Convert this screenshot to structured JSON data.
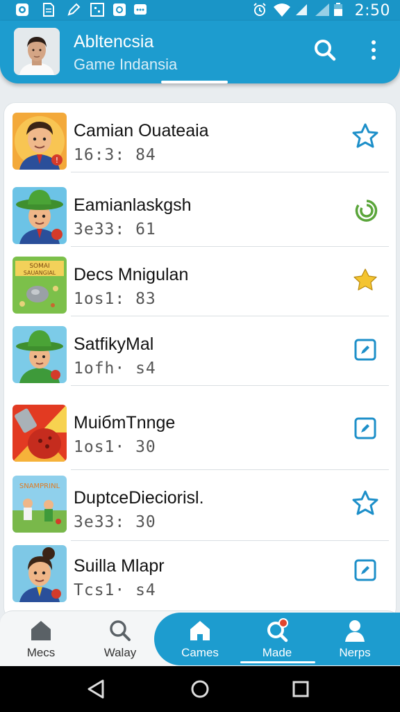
{
  "status_bar": {
    "time": "2:50",
    "left_icons": [
      "app-icon",
      "document-icon",
      "edit-icon",
      "grid-icon",
      "photo-icon",
      "message-icon"
    ],
    "right_icons": [
      "alarm-icon",
      "wifi-icon",
      "signal-icon",
      "battery-icon"
    ]
  },
  "app_bar": {
    "title": "Abltencsia",
    "subtitle": "Game Indansia",
    "actions": [
      "search-icon",
      "more-vert-icon"
    ]
  },
  "list": {
    "items": [
      {
        "title": "Camian Ouateaia",
        "subtitle": "16:3: 84",
        "action_icon": "star-outline-icon"
      },
      {
        "title": "Eamianlaskgsh",
        "subtitle": "3e33: 61",
        "action_icon": "sync-icon"
      },
      {
        "title": "Decs Mnigulan",
        "subtitle": "1os1: 83",
        "action_icon": "star-filled-icon"
      },
      {
        "title": "SatfikyMal",
        "subtitle": "1ofh· s4",
        "action_icon": "edit-box-icon"
      },
      {
        "title": "MuiбmTnnge",
        "subtitle": "1os1· 30",
        "action_icon": "edit-box-icon"
      },
      {
        "title": "DuptceDieciorisl.",
        "subtitle": "3e33: 30",
        "action_icon": "star-outline-icon"
      },
      {
        "title": "Suilla Mlapr",
        "subtitle": "Tcs1· s4",
        "action_icon": "edit-box-icon"
      }
    ]
  },
  "thumbnail_texts": {
    "item3": "SOMAI SAUANGIAL",
    "item6": "SNAMPRINL"
  },
  "bottom_nav": {
    "items": [
      {
        "label": "Mecs",
        "icon": "home-icon"
      },
      {
        "label": "Walay",
        "icon": "search-icon"
      },
      {
        "label": "Cames",
        "icon": "home-icon"
      },
      {
        "label": "Made",
        "icon": "search-badge-icon"
      },
      {
        "label": "Nerps",
        "icon": "person-icon"
      }
    ],
    "active_index": 3
  },
  "colors": {
    "primary": "#1d9ccf",
    "status_bar": "#1a95c7",
    "star_outline": "#1d8fc9",
    "star_filled": "#f4c430",
    "sync_green": "#5aa53a",
    "badge_red": "#e0452e"
  }
}
